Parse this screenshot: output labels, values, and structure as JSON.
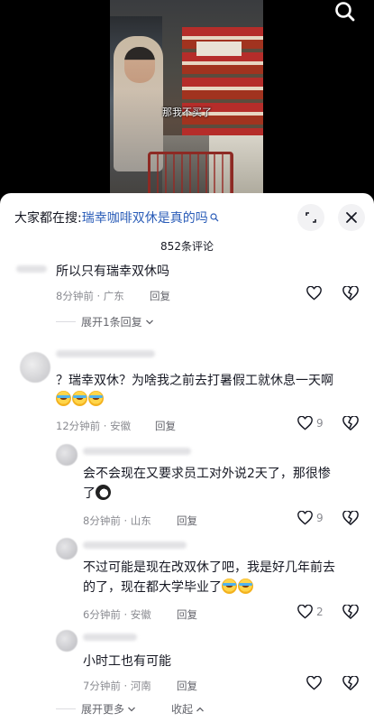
{
  "video": {
    "subtitle": "那我不买了",
    "search_icon": "search-icon"
  },
  "panel": {
    "search_prefix": "大家都在搜:",
    "search_keyword": "瑞幸咖啡双休是真的吗",
    "comment_count": "852条评论",
    "expand_icon": "expand-icon",
    "close_icon": "close-icon"
  },
  "comments": [
    {
      "text": "所以只有瑞幸双休吗",
      "time": "8分钟前",
      "location": "广东",
      "reply": "回复",
      "likes": "",
      "expand": "展开1条回复"
    },
    {
      "text": "？瑞幸双休？为啥我之前去打暑假工就休息一天啊",
      "time": "12分钟前",
      "location": "安徽",
      "reply": "回复",
      "likes": "9"
    },
    {
      "text1": "会不会现在又要求员工对外说2天了，那很惨",
      "text2": "了",
      "time": "8分钟前",
      "location": "山东",
      "reply": "回复",
      "likes": "9"
    },
    {
      "text1": "不过可能是现在改双休了吧，我是好几年前去",
      "text2": "的了，现在都大学毕业了",
      "time": "6分钟前",
      "location": "安徽",
      "reply": "回复",
      "likes": "2"
    },
    {
      "text": "小时工也有可能",
      "time": "7分钟前",
      "location": "河南",
      "reply": "回复",
      "likes": ""
    }
  ],
  "footer": {
    "expand_more": "展开更多",
    "collapse": "收起"
  },
  "sep": " · "
}
